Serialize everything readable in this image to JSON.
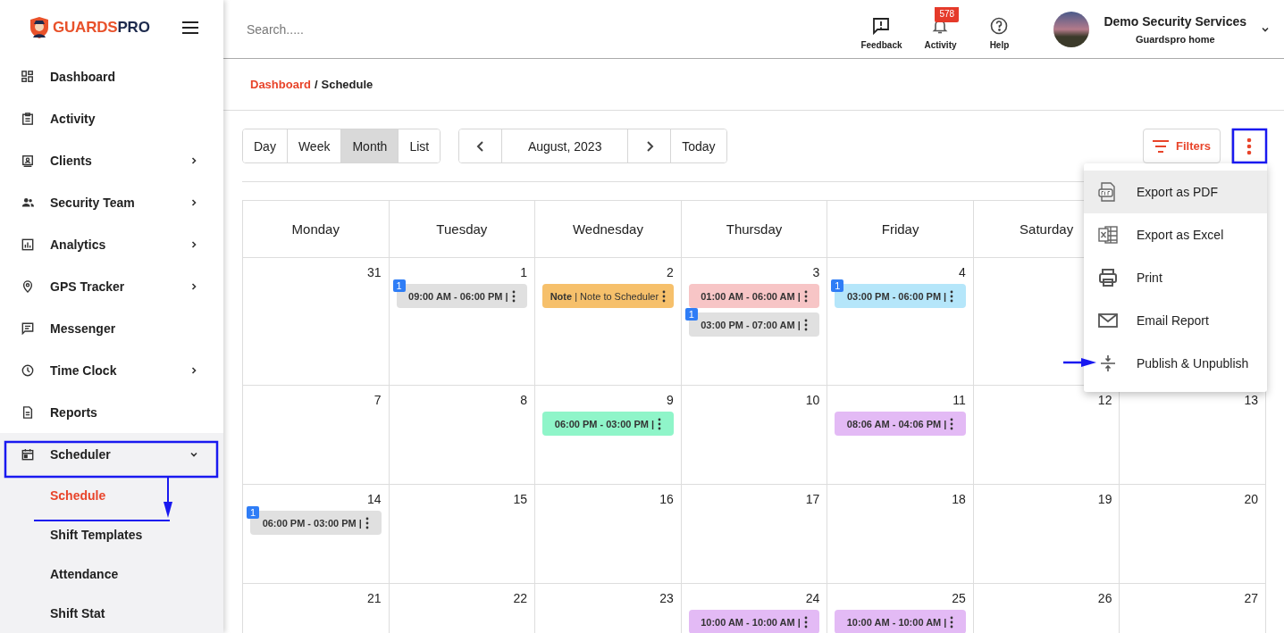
{
  "brand": {
    "name_part_1": "GUARDS",
    "name_part_2": "PRO"
  },
  "sidebar": {
    "items": [
      {
        "label": "Dashboard",
        "kind": "link"
      },
      {
        "label": "Activity",
        "kind": "link"
      },
      {
        "label": "Clients",
        "kind": "group",
        "expanded": false
      },
      {
        "label": "Security Team",
        "kind": "group",
        "expanded": false
      },
      {
        "label": "Analytics",
        "kind": "group",
        "expanded": false
      },
      {
        "label": "GPS Tracker",
        "kind": "group",
        "expanded": false
      },
      {
        "label": "Messenger",
        "kind": "link"
      },
      {
        "label": "Time Clock",
        "kind": "group",
        "expanded": false
      },
      {
        "label": "Reports",
        "kind": "link"
      },
      {
        "label": "Scheduler",
        "kind": "group",
        "expanded": true,
        "children": [
          {
            "label": "Schedule",
            "selected": true
          },
          {
            "label": "Shift Templates",
            "selected": false
          },
          {
            "label": "Attendance",
            "selected": false
          },
          {
            "label": "Shift Stat",
            "selected": false
          }
        ]
      }
    ]
  },
  "topbar": {
    "search": {
      "placeholder": "Search....."
    },
    "actions": [
      {
        "label": "Feedback"
      },
      {
        "label": "Activity",
        "badge": "578"
      },
      {
        "label": "Help"
      }
    ],
    "account": {
      "name": "Demo Security Services",
      "subtitle": "Guardspro home"
    }
  },
  "breadcrumb": {
    "parent": "Dashboard",
    "separator": "/",
    "current": "Schedule"
  },
  "toolbar": {
    "views": [
      {
        "label": "Day",
        "selected": false
      },
      {
        "label": "Week",
        "selected": false
      },
      {
        "label": "Month",
        "selected": true
      },
      {
        "label": "List",
        "selected": false
      }
    ],
    "period": "August, 2023",
    "today": "Today",
    "filters": "Filters"
  },
  "menu": {
    "items": [
      {
        "label": "Export as PDF",
        "selected": true
      },
      {
        "label": "Export as Excel",
        "selected": false
      },
      {
        "label": "Print",
        "selected": false
      },
      {
        "label": "Email Report",
        "selected": false
      },
      {
        "label": "Publish & Unpublish",
        "selected": false
      }
    ]
  },
  "calendar": {
    "weekdays": [
      "Monday",
      "Tuesday",
      "Wednesday",
      "Thursday",
      "Friday",
      "Saturday"
    ],
    "weeks": [
      [
        {
          "date": "31"
        },
        {
          "date": "1",
          "events": [
            {
              "kind": "shift",
              "text": "09:00 AM - 06:00 PM |",
              "color": "#e0e0e0",
              "badge": "1"
            }
          ]
        },
        {
          "date": "2",
          "events": [
            {
              "kind": "note",
              "text": "**Note** | Note to Scheduler",
              "color": "#f6c06b"
            }
          ]
        },
        {
          "date": "3",
          "events": [
            {
              "kind": "shift",
              "text": "01:00 AM - 06:00 AM |",
              "color": "#f7c5c6"
            },
            {
              "kind": "shift",
              "text": "03:00 PM - 07:00 AM |",
              "color": "#e0e0e0",
              "badge": "1"
            }
          ]
        },
        {
          "date": "4",
          "events": [
            {
              "kind": "shift",
              "text": "03:00 PM - 06:00 PM |",
              "color": "#b5e6fa",
              "badge": "1"
            }
          ]
        }
      ],
      [
        {
          "date": "7"
        },
        {
          "date": "8"
        },
        {
          "date": "9",
          "events": [
            {
              "kind": "shift",
              "text": "06:00 PM - 03:00 PM |",
              "color": "#8ff5c9"
            }
          ]
        },
        {
          "date": "10"
        },
        {
          "date": "11",
          "events": [
            {
              "kind": "shift",
              "text": "08:06 AM - 04:06 PM |",
              "color": "#e3baf5"
            }
          ]
        },
        {
          "date": "12"
        },
        {
          "date": "13"
        }
      ],
      [
        {
          "date": "14",
          "events": [
            {
              "kind": "shift",
              "text": "06:00 PM - 03:00 PM |",
              "color": "#e0e0e0",
              "badge": "1"
            }
          ]
        },
        {
          "date": "15"
        },
        {
          "date": "16"
        },
        {
          "date": "17"
        },
        {
          "date": "18"
        },
        {
          "date": "19"
        },
        {
          "date": "20"
        }
      ],
      [
        {
          "date": "21"
        },
        {
          "date": "22"
        },
        {
          "date": "23"
        },
        {
          "date": "24",
          "events": [
            {
              "kind": "shift",
              "text": "10:00 AM - 10:00 AM |",
              "color": "#e3baf5"
            }
          ]
        },
        {
          "date": "25",
          "events": [
            {
              "kind": "shift",
              "text": "10:00 AM - 10:00 AM |",
              "color": "#e3baf5"
            }
          ]
        },
        {
          "date": "26"
        },
        {
          "date": "27"
        }
      ]
    ]
  }
}
